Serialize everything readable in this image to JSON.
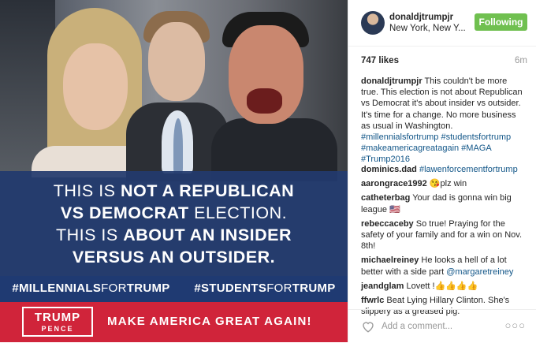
{
  "image": {
    "banner_lines": [
      {
        "pre": "THIS IS ",
        "bold": "NOT A REPUBLICAN",
        "post": ""
      },
      {
        "pre": "",
        "bold": "VS DEMOCRAT",
        "post": " ELECTION."
      },
      {
        "pre": "THIS IS ",
        "bold": "ABOUT AN INSIDER",
        "post": ""
      },
      {
        "pre": "",
        "bold": "VERSUS AN OUTSIDER.",
        "post": ""
      }
    ],
    "tag_left_a": "#MILLENNIALS",
    "tag_left_b": "FOR",
    "tag_left_c": "TRUMP",
    "tag_right_a": "#STUDENTS",
    "tag_right_b": "FOR",
    "tag_right_c": "TRUMP",
    "logo_top": "TRUMP",
    "logo_bottom": "PENCE",
    "slogan": "MAKE AMERICA GREAT AGAIN!",
    "colors": {
      "banner": "#223a6e",
      "red": "#d0243a"
    }
  },
  "header": {
    "username": "donaldjtrumpjr",
    "location": "New York, New Y...",
    "follow_label": "Following",
    "follow_color": "#70c050"
  },
  "stats": {
    "likes": "747 likes",
    "time": "6m"
  },
  "caption": {
    "user": "donaldjtrumpjr",
    "text": " This couldn't be more true. This election is not about Republican vs Democrat it's about insider vs outsider. It's time for a change. No more business as usual in Washington. ",
    "tags": "#millennialsfortrump #studentsfortrump #makeamericagreatagain #MAGA #Trump2016"
  },
  "comments": [
    {
      "user": "dominics.dad",
      "text": "",
      "tag": "#lawenforcementfortrump"
    },
    {
      "user": "aarongrace1992",
      "text": " 😘plz win",
      "tag": ""
    },
    {
      "user": "catheterbag",
      "text": " Your dad is gonna win big league 🇺🇸",
      "tag": ""
    },
    {
      "user": "rebeccaceby",
      "text": " So true! Praying for the safety of your family and for a win on Nov. 8th!",
      "tag": ""
    },
    {
      "user": "michaelreiney",
      "text": " He looks a hell of a lot better with a side part ",
      "tag": "@margaretreiney"
    },
    {
      "user": "jeandglam",
      "text": " Lovett !👍👍👍👍",
      "tag": ""
    },
    {
      "user": "ffwrlc",
      "text": " Beat Lying Hillary Clinton. She's slippery as a greased pig.",
      "tag": ""
    }
  ],
  "footer": {
    "placeholder": "Add a comment...",
    "more": "○○○",
    "icon": "heart-icon"
  }
}
